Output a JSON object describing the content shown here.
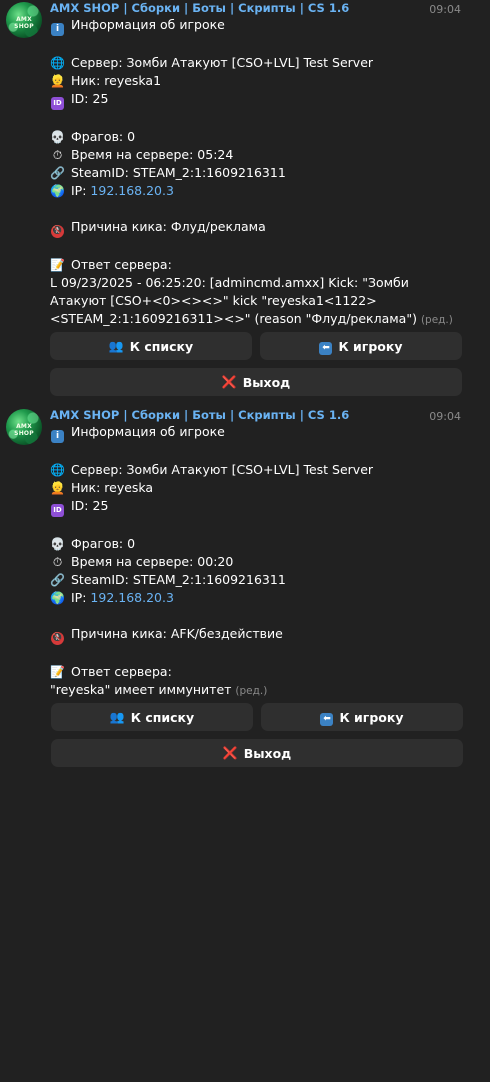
{
  "messages": [
    {
      "avatar_text": "AMX SHOP",
      "sender": "AMX SHOP | Сборки | Боты | Скрипты | CS 1.6",
      "time": "09:04",
      "title": "Информация об игроке",
      "server": "Сервер: Зомби Атакуют [CSO+LVL] Test Server",
      "nick": "Ник: reyeska1",
      "id": "ID: 25",
      "frags": "Фрагов: 0",
      "playtime": "Время на сервере: 05:24",
      "steamid": "SteamID: STEAM_2:1:1609216311",
      "ip_label": "IP: ",
      "ip": "192.168.20.3",
      "kick_reason": "Причина кика: Флуд/реклама",
      "response_label": "Ответ сервера:",
      "response_text": "L 09/23/2025 - 06:25:20: [admincmd.amxx] Kick: \"Зомби Атакуют [CSO+<0><><>\" kick \"reyeska1<1122><STEAM_2:1:1609216311><>\" (reason \"Флуд/реклама\")",
      "edited": "(ред.)",
      "buttons": {
        "to_list": "К списку",
        "to_player": "К игроку",
        "exit": "Выход"
      }
    },
    {
      "avatar_text": "AMX SHOP",
      "sender": "AMX SHOP | Сборки | Боты | Скрипты | CS 1.6",
      "time": "09:04",
      "title": "Информация об игроке",
      "server": "Сервер: Зомби Атакуют [CSO+LVL] Test Server",
      "nick": "Ник: reyeska",
      "id": "ID: 25",
      "frags": "Фрагов: 0",
      "playtime": "Время на сервере: 00:20",
      "steamid": "SteamID: STEAM_2:1:1609216311",
      "ip_label": "IP: ",
      "ip": "192.168.20.3",
      "kick_reason": "Причина кика: AFK/бездействие",
      "response_label": "Ответ сервера:",
      "response_text": "\"reyeska\" имеет иммунитет",
      "edited": "(ред.)",
      "buttons": {
        "to_list": "К списку",
        "to_player": "К игроку",
        "exit": "Выход"
      }
    }
  ],
  "icons": {
    "info": "info-icon",
    "globe": "globe-icon",
    "person": "person-icon",
    "id": "id-icon",
    "skull": "skull-icon",
    "stopwatch": "stopwatch-icon",
    "link": "link-icon",
    "earth": "earth-icon",
    "no-pedestrians": "no-pedestrians-icon",
    "memo": "memo-icon",
    "users": "users-icon",
    "back-arrow": "back-arrow-icon",
    "cross": "cross-icon"
  },
  "colors": {
    "background": "#212121",
    "button": "#2f2f2f",
    "accent": "#6ab3f3",
    "muted": "#8a8a8a"
  }
}
